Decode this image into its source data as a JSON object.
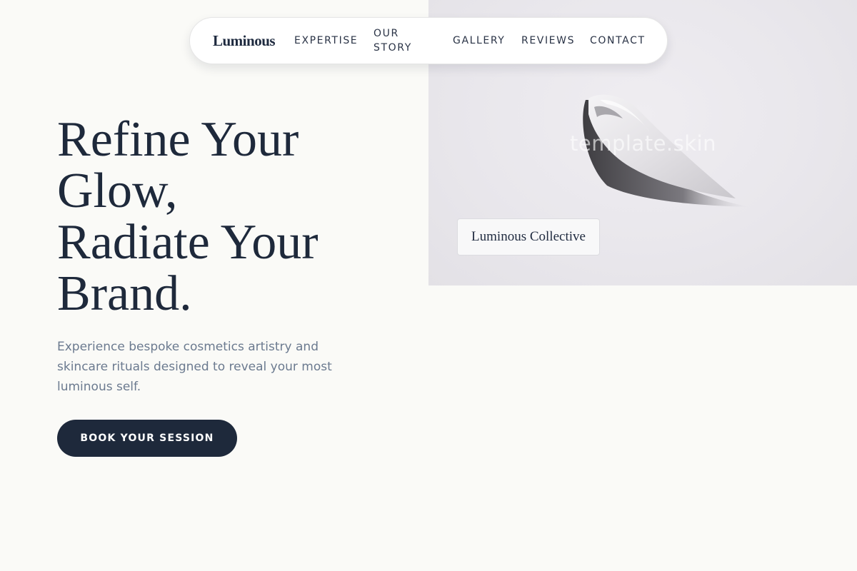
{
  "brand": {
    "name": "Luminous"
  },
  "nav": {
    "links": [
      "EXPERTISE",
      "OUR STORY",
      "GALLERY",
      "REVIEWS",
      "CONTACT"
    ]
  },
  "hero": {
    "headline_lines": [
      "Refine Your",
      "Glow,",
      "Radiate Your",
      "Brand."
    ],
    "subtext": "Experience bespoke cosmetics artistry and skincare rituals designed to reveal your most luminous self.",
    "cta_label": "BOOK YOUR SESSION",
    "image_watermark": "template.skin",
    "image_caption": "Luminous Collective"
  },
  "colors": {
    "background": "#fafaf7",
    "primary_navy": "#1e293b",
    "subtext_gray": "#6b7a8f",
    "image_panel": "#e9e7ec"
  }
}
